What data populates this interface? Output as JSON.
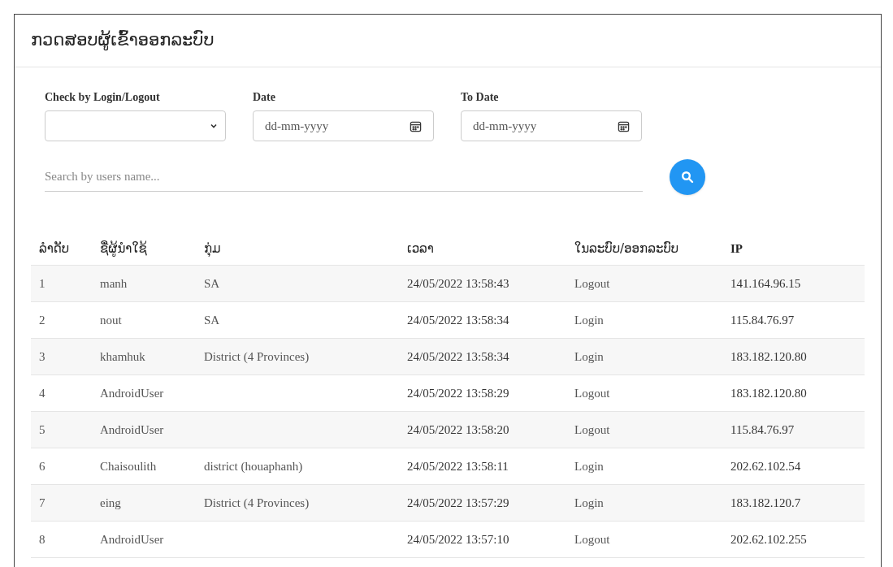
{
  "title": "ກວດສອບຜູ້ເຂົ້າອອກລະບົບ",
  "filters": {
    "login_select": {
      "label": "Check by Login/Logout"
    },
    "date": {
      "label": "Date",
      "placeholder": "dd-mm-yyyy"
    },
    "to_date": {
      "label": "To Date",
      "placeholder": "dd-mm-yyyy"
    },
    "search": {
      "placeholder": "Search by users name..."
    }
  },
  "table": {
    "columns": [
      "ລຳດັບ",
      "ຊື່ຜູ້ນຳໃຊ້",
      "ກຸ່ມ",
      "ເວລາ",
      "ໃນລະບົບ/ອອກລະບົບ",
      "IP"
    ],
    "rows": [
      [
        "1",
        "manh",
        "SA",
        "24/05/2022 13:58:43",
        "Logout",
        "141.164.96.15"
      ],
      [
        "2",
        "nout",
        "SA",
        "24/05/2022 13:58:34",
        "Login",
        "115.84.76.97"
      ],
      [
        "3",
        "khamhuk",
        "District (4 Provinces)",
        "24/05/2022 13:58:34",
        "Login",
        "183.182.120.80"
      ],
      [
        "4",
        "AndroidUser",
        "",
        "24/05/2022 13:58:29",
        "Logout",
        "183.182.120.80"
      ],
      [
        "5",
        "AndroidUser",
        "",
        "24/05/2022 13:58:20",
        "Logout",
        "115.84.76.97"
      ],
      [
        "6",
        "Chaisoulith",
        "district (houaphanh)",
        "24/05/2022 13:58:11",
        "Login",
        "202.62.102.54"
      ],
      [
        "7",
        "eing",
        "District (4 Provinces)",
        "24/05/2022 13:57:29",
        "Login",
        "183.182.120.7"
      ],
      [
        "8",
        "AndroidUser",
        "",
        "24/05/2022 13:57:10",
        "Logout",
        "202.62.102.255"
      ]
    ]
  }
}
